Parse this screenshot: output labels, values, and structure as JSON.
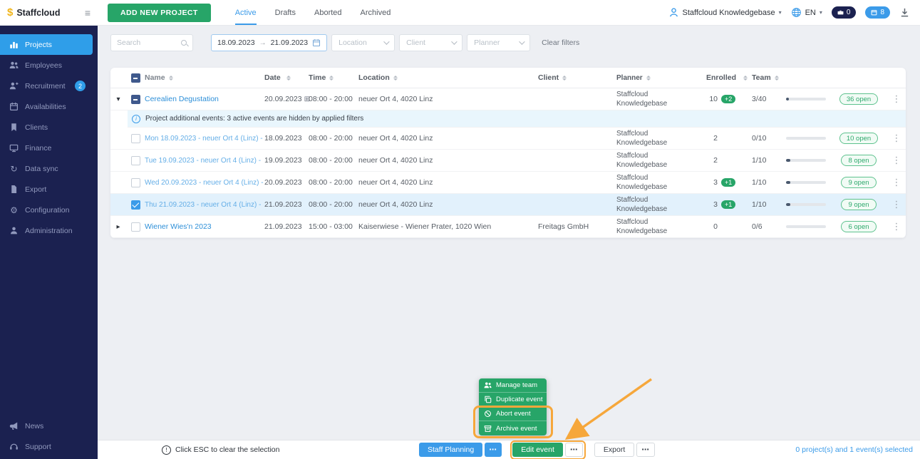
{
  "colors": {
    "accent_blue": "#3b9be9",
    "green": "#27a568",
    "orange": "#f6a73b",
    "sidebar_bg": "#1b2150",
    "selected_row": "#e2f1fc",
    "info_row": "#e9f6fd"
  },
  "topbar": {
    "logo": "Staffcloud",
    "add_new_project": "ADD NEW PROJECT",
    "tabs": [
      {
        "label": "Active",
        "active": true
      },
      {
        "label": "Drafts",
        "active": false
      },
      {
        "label": "Aborted",
        "active": false
      },
      {
        "label": "Archived",
        "active": false
      }
    ],
    "user_name": "Staffcloud Knowledgebase",
    "language": "EN",
    "counter_dark": "0",
    "counter_blue": "8"
  },
  "sidebar": {
    "items": [
      {
        "label": "Projects",
        "icon": "projects-icon",
        "active": true
      },
      {
        "label": "Employees",
        "icon": "employees-icon"
      },
      {
        "label": "Recruitment",
        "icon": "recruitment-icon",
        "badge": "2"
      },
      {
        "label": "Availabilities",
        "icon": "availabilities-icon"
      },
      {
        "label": "Clients",
        "icon": "clients-icon"
      },
      {
        "label": "Finance",
        "icon": "finance-icon"
      },
      {
        "label": "Data sync",
        "icon": "data-sync-icon"
      },
      {
        "label": "Export",
        "icon": "export-icon"
      },
      {
        "label": "Configuration",
        "icon": "configuration-icon"
      },
      {
        "label": "Administration",
        "icon": "administration-icon"
      }
    ],
    "footer_items": [
      {
        "label": "News",
        "icon": "news-icon"
      },
      {
        "label": "Support",
        "icon": "support-icon"
      }
    ]
  },
  "filters": {
    "search_placeholder": "Search",
    "date_from": "18.09.2023",
    "date_to": "21.09.2023",
    "location_placeholder": "Location",
    "client_placeholder": "Client",
    "planner_placeholder": "Planner",
    "clear_label": "Clear filters"
  },
  "table": {
    "headers": [
      "Name",
      "Date",
      "Time",
      "Location",
      "Client",
      "Planner",
      "Enrolled",
      "Team"
    ],
    "rows": [
      {
        "type": "parent",
        "caret": "down",
        "check": "indeterminate",
        "name": "Cerealien Degustation",
        "date": "20.09.2023",
        "date_icon": true,
        "time": "08:00 - 20:00",
        "location": "neuer Ort 4, 4020 Linz",
        "client": "",
        "planner": "Staffcloud Knowledgebase",
        "enrolled": "10",
        "enrolled_badge": "+2",
        "team": "3/40",
        "progress_pct": 8,
        "open": "36 open"
      },
      {
        "type": "info",
        "text": "Project additional events:  3 active events are hidden by applied filters"
      },
      {
        "type": "child",
        "check": "unchecked",
        "name": "Mon 18.09.2023 - neuer Ort 4 (Linz) -",
        "date": "18.09.2023",
        "time": "08:00 - 20:00",
        "location": "neuer Ort 4, 4020 Linz",
        "client": "",
        "planner": "Staffcloud Knowledgebase",
        "enrolled": "2",
        "team": "0/10",
        "progress_pct": 0,
        "open": "10 open"
      },
      {
        "type": "child",
        "check": "unchecked",
        "name": "Tue 19.09.2023 - neuer Ort 4 (Linz) -",
        "date": "19.09.2023",
        "time": "08:00 - 20:00",
        "location": "neuer Ort 4, 4020 Linz",
        "client": "",
        "planner": "Staffcloud Knowledgebase",
        "enrolled": "2",
        "team": "1/10",
        "progress_pct": 10,
        "open": "8 open"
      },
      {
        "type": "child",
        "check": "unchecked",
        "name": "Wed 20.09.2023 - neuer Ort 4 (Linz) -",
        "date": "20.09.2023",
        "time": "08:00 - 20:00",
        "location": "neuer Ort 4, 4020 Linz",
        "client": "",
        "planner": "Staffcloud Knowledgebase",
        "enrolled": "3",
        "enrolled_badge": "+1",
        "team": "1/10",
        "progress_pct": 10,
        "open": "9 open"
      },
      {
        "type": "child",
        "check": "checked",
        "selected": true,
        "name": "Thu 21.09.2023 - neuer Ort 4 (Linz) -",
        "date": "21.09.2023",
        "time": "08:00 - 20:00",
        "location": "neuer Ort 4, 4020 Linz",
        "client": "",
        "planner": "Staffcloud Knowledgebase",
        "enrolled": "3",
        "enrolled_badge": "+1",
        "team": "1/10",
        "progress_pct": 10,
        "open": "9 open"
      },
      {
        "type": "parent",
        "caret": "right",
        "check": "unchecked",
        "name": "Wiener Wies'n 2023",
        "date": "21.09.2023",
        "time": "15:00 - 03:00",
        "location": "Kaiserwiese - Wiener Prater, 1020 Wien",
        "client": "Freitags GmbH",
        "planner": "Staffcloud Knowledgebase",
        "enrolled": "0",
        "team": "0/6",
        "progress_pct": 0,
        "open": "6 open"
      }
    ]
  },
  "context_menu": {
    "items": [
      {
        "label": "Manage team",
        "icon": "team-icon"
      },
      {
        "label": "Duplicate event",
        "icon": "duplicate-icon"
      },
      {
        "label": "Abort event",
        "icon": "abort-icon",
        "highlighted": true
      },
      {
        "label": "Archive event",
        "icon": "archive-icon",
        "highlighted": true
      }
    ]
  },
  "footer": {
    "esc_hint": "Click ESC to clear the selection",
    "staff_planning_label": "Staff Planning",
    "edit_event_label": "Edit event",
    "export_label": "Export",
    "selection_status": "0 project(s) and 1 event(s) selected"
  }
}
